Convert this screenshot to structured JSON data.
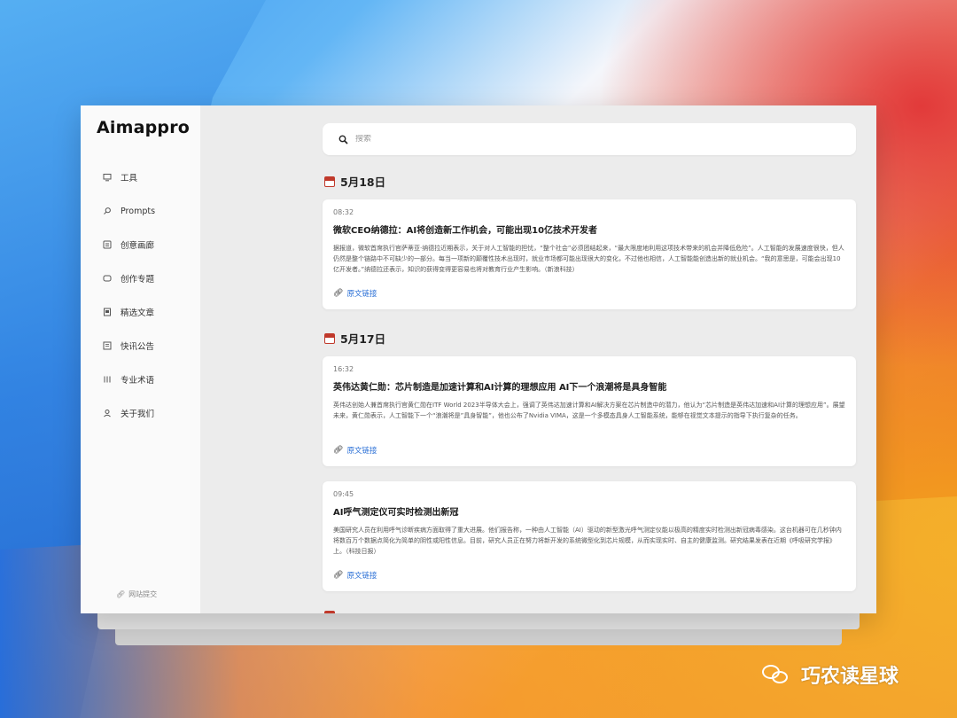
{
  "brand": {
    "logo": "Aimappro"
  },
  "sidebar": {
    "items": [
      {
        "label": "工具",
        "icon": "monitor-icon"
      },
      {
        "label": "Prompts",
        "icon": "search-icon"
      },
      {
        "label": "创意画廊",
        "icon": "gallery-icon"
      },
      {
        "label": "创作专题",
        "icon": "topic-icon"
      },
      {
        "label": "精选文章",
        "icon": "article-icon"
      },
      {
        "label": "快讯公告",
        "icon": "news-icon"
      },
      {
        "label": "专业术语",
        "icon": "terms-icon"
      },
      {
        "label": "关于我们",
        "icon": "user-icon"
      }
    ],
    "submit": "网站提交"
  },
  "search": {
    "placeholder": "搜索"
  },
  "groups": [
    {
      "date": "5月18日",
      "items": [
        {
          "time": "08:32",
          "title": "微软CEO纳德拉：AI将创造新工作机会，可能出现10亿技术开发者",
          "body": "据报道，微软首席执行官萨蒂亚·纳德拉近期表示，关于对人工智能的担忧，“整个社会”必须团结起来，“最大限度地利用这项技术带来的机会并降低危险”。人工智能的发展速度很快，但人仍然是整个链路中不可缺少的一部分。每当一项新的颠覆性技术出现时，就业市场都可能出现很大的变化，不过他也相信，人工智能能创造出新的就业机会。“我的意思是，可能会出现10亿开发者。”纳德拉还表示，知识的获得变得更容易也将对教育行业产生影响。（新浪科技）",
          "link": "原文链接"
        }
      ]
    },
    {
      "date": "5月17日",
      "items": [
        {
          "time": "16:32",
          "title": "英伟达黄仁勋：芯片制造是加速计算和AI计算的理想应用 AI下一个浪潮将是具身智能",
          "body": "英伟达创始人兼首席执行官黄仁勋在ITF World 2023半导体大会上，强调了英伟达加速计算和AI解决方案在芯片制造中的潜力，他认为“芯片制造是英伟达加速和AI计算的理想应用”。展望未来，黄仁勋表示，人工智能下一个“浪潮将是”具身智能”，他也公布了Nvidia VIMA，这是一个多模态具身人工智能系统，能够在视觉文本提示的指导下执行复杂的任务。",
          "link": "原文链接"
        },
        {
          "time": "09:45",
          "title": "AI呼气测定仪可实时检测出新冠",
          "body": "美国研究人员在利用呼气诊断疾病方面取得了重大进展。他们报告称，一种由人工智能（AI）驱动的新型激光呼气测定仪能以极高的精度实时检测出新冠病毒感染。这台机器可在几秒钟内将数百万个数据点简化为简单的阴性或阳性信息。目前，研究人员正在努力将新开发的系统微型化到芯片规模，从而实现实时、自主的健康监测。研究结果发表在近期《呼吸研究学报》上。（科技日报）",
          "link": "原文链接"
        }
      ]
    }
  ],
  "watermark": {
    "text": "巧农读星球"
  }
}
